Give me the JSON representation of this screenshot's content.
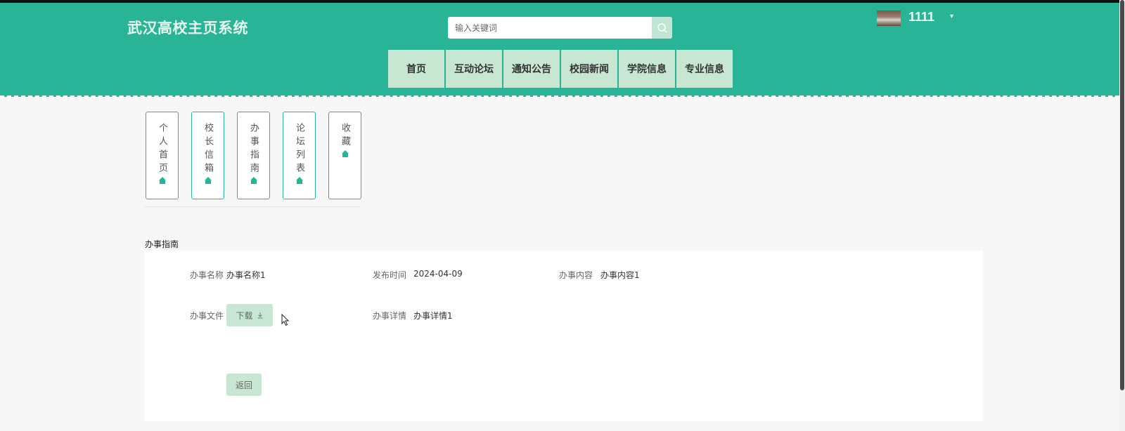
{
  "header": {
    "site_title": "武汉高校主页系统",
    "search": {
      "placeholder": "输入关键词",
      "icon": "search-icon"
    },
    "user": {
      "name": "1111",
      "caret": "▾"
    },
    "nav": [
      {
        "label": "首页"
      },
      {
        "label": "互动论坛"
      },
      {
        "label": "通知公告"
      },
      {
        "label": "校园新闻"
      },
      {
        "label": "学院信息"
      },
      {
        "label": "专业信息"
      }
    ]
  },
  "sub_menu": [
    {
      "label": "个人首页",
      "icon": "home-icon"
    },
    {
      "label": "校长信箱",
      "icon": "home-icon"
    },
    {
      "label": "办事指南",
      "icon": "home-icon"
    },
    {
      "label": "论坛列表",
      "icon": "home-icon"
    },
    {
      "label": "收藏",
      "icon": "home-icon"
    }
  ],
  "detail": {
    "section_title": "办事指南",
    "name_label": "办事名称",
    "name_value": "办事名称1",
    "time_label": "发布时间",
    "time_value": "2024-04-09",
    "content_label": "办事内容",
    "content_value": "办事内容1",
    "file_label": "办事文件",
    "download_label": "下载",
    "download_icon": "download-icon",
    "detail_label": "办事详情",
    "detail_value": "办事详情1",
    "back_label": "返回"
  },
  "colors": {
    "primary": "#29b497",
    "nav_bg": "#c7e7d3",
    "page_bg": "#f7f7f7"
  }
}
